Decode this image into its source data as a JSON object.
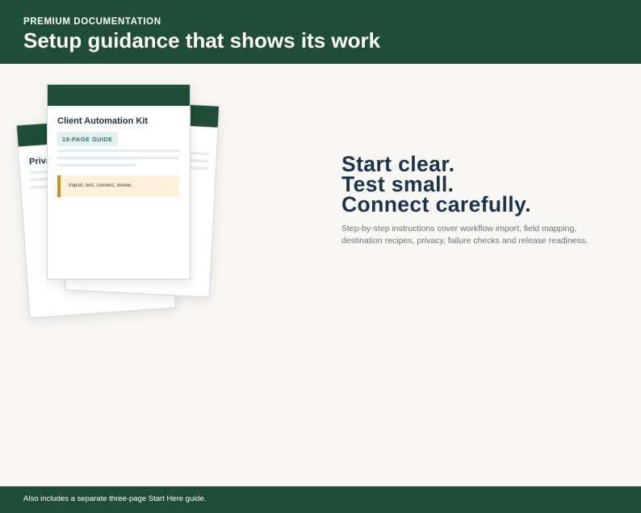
{
  "header": {
    "eyebrow": "PREMIUM DOCUMENTATION",
    "title": "Setup guidance that shows its work"
  },
  "documents": {
    "front": {
      "title": "Client Automation Kit",
      "badge": "19-PAGE GUIDE",
      "callout": "Import, test, connect, review."
    },
    "back_left": {
      "title_visible": "Priva"
    }
  },
  "hero": {
    "lines": [
      "Start clear.",
      "Test small.",
      "Connect carefully."
    ],
    "body": "Step-by-step instructions cover workflow import, field mapping, destination recipes, privacy, failure checks and release readiness."
  },
  "footer": {
    "note": "Also includes a separate three-page Start Here guide."
  },
  "colors": {
    "brand_green": "#1f4d35",
    "navy": "#1b324b",
    "accent_amber": "#c9902d",
    "background": "#f8f7f3"
  }
}
